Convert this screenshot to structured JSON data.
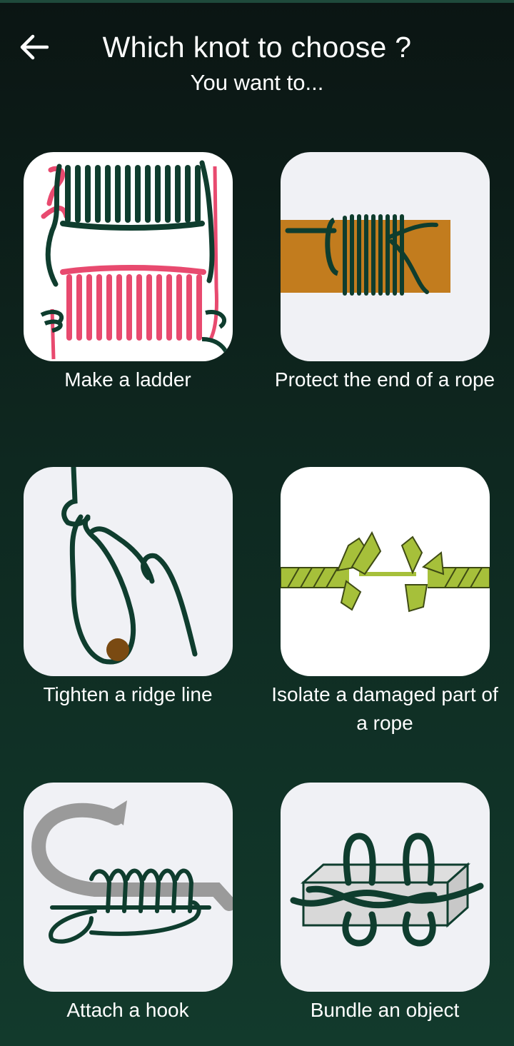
{
  "header": {
    "title": "Which knot to choose ?",
    "subtitle": "You want to..."
  },
  "colors": {
    "rope_green": "#0f3d2e",
    "rope_pink": "#e84a6f",
    "wood": "#c27c1e",
    "damaged_rope": "#a6c03a",
    "hook_gray": "#9a9a9a",
    "tile_bg": "#f0f1f5"
  },
  "options": [
    {
      "label": "Make a ladder",
      "icon": "ladder-knot-icon"
    },
    {
      "label": "Protect the end of a rope",
      "icon": "whipping-knot-icon"
    },
    {
      "label": "Tighten a ridge line",
      "icon": "ridge-line-knot-icon"
    },
    {
      "label": "Isolate a damaged part of a rope",
      "icon": "damaged-rope-icon"
    },
    {
      "label": "Attach a hook",
      "icon": "fishing-hook-knot-icon"
    },
    {
      "label": "Bundle an object",
      "icon": "bundle-knot-icon"
    }
  ]
}
